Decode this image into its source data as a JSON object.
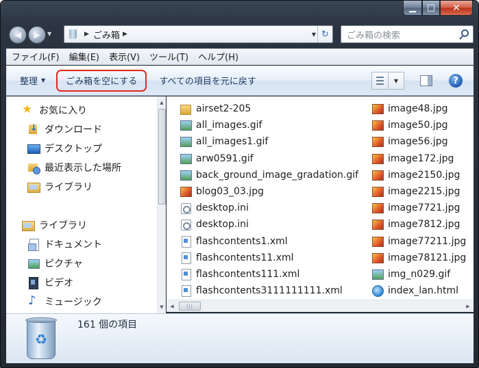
{
  "caption": {
    "min": "▁",
    "max": "□",
    "close": "✕"
  },
  "address": {
    "location": "ごみ箱",
    "search_placeholder": "ごみ箱の検索"
  },
  "menu": [
    "ファイル(F)",
    "編集(E)",
    "表示(V)",
    "ツール(T)",
    "ヘルプ(H)"
  ],
  "commands": {
    "organize": "整理",
    "empty_bin": "ごみ箱を空にする",
    "restore_all": "すべての項目を元に戻す"
  },
  "nav": {
    "favorites": "お気に入り",
    "downloads": "ダウンロード",
    "desktop": "デスクトップ",
    "recent": "最近表示した場所",
    "libraries_fav": "ライブラリ",
    "libraries": "ライブラリ",
    "documents": "ドキュメント",
    "pictures": "ピクチャ",
    "videos": "ビデオ",
    "music": "ミュージック"
  },
  "files_col1": [
    {
      "name": "airset2-205",
      "icon": "folder-icon"
    },
    {
      "name": "all_images.gif",
      "icon": "gif-icon"
    },
    {
      "name": "all_images1.gif",
      "icon": "gif-icon"
    },
    {
      "name": "arw0591.gif",
      "icon": "gif-icon"
    },
    {
      "name": "back_ground_image_gradation.gif",
      "icon": "gif-icon"
    },
    {
      "name": "blog03_03.jpg",
      "icon": "jpg-icon"
    },
    {
      "name": "desktop.ini",
      "icon": "ini-icon"
    },
    {
      "name": "desktop.ini",
      "icon": "ini-icon"
    },
    {
      "name": "flashcontents1.xml",
      "icon": "xml-icon"
    },
    {
      "name": "flashcontents11.xml",
      "icon": "xml-icon"
    },
    {
      "name": "flashcontents111.xml",
      "icon": "xml-icon"
    },
    {
      "name": "flashcontents3111111111.xml",
      "icon": "xml-icon"
    }
  ],
  "files_col2": [
    {
      "name": "image48.jpg",
      "icon": "jpg-icon"
    },
    {
      "name": "image50.jpg",
      "icon": "jpg-icon"
    },
    {
      "name": "image56.jpg",
      "icon": "jpg-icon"
    },
    {
      "name": "image172.jpg",
      "icon": "jpg-icon"
    },
    {
      "name": "image2150.jpg",
      "icon": "jpg-icon"
    },
    {
      "name": "image2215.jpg",
      "icon": "jpg-icon"
    },
    {
      "name": "image7721.jpg",
      "icon": "jpg-icon"
    },
    {
      "name": "image7812.jpg",
      "icon": "jpg-icon"
    },
    {
      "name": "image77211.jpg",
      "icon": "jpg-icon"
    },
    {
      "name": "image78121.jpg",
      "icon": "jpg-icon"
    },
    {
      "name": "img_n029.gif",
      "icon": "gif-icon"
    },
    {
      "name": "index_lan.html",
      "icon": "html-icon"
    }
  ],
  "details": {
    "item_count": "161 個の項目"
  },
  "colors": {
    "highlight_border": "#e0261c",
    "window_frame": "#2b3440"
  }
}
